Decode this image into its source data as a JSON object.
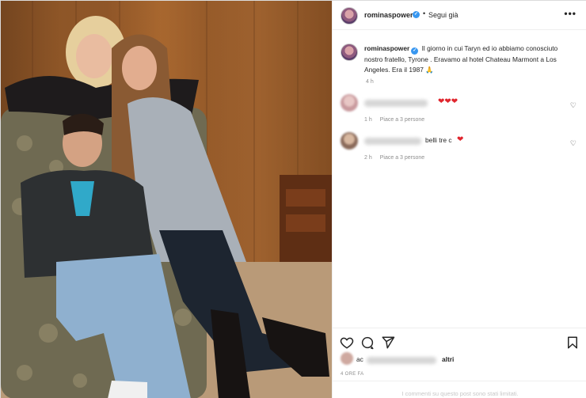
{
  "post": {
    "username": "rominaspower",
    "follow_label": "Segui già",
    "more_label": "•••",
    "caption_username": "rominaspower",
    "caption_text": " Il giorno in cui Taryn ed io abbiamo conosciuto nostro fratello, Tyrone . Eravamo al hotel Chateau Marmont a Los Angeles. Era il 1987 🙏",
    "caption_time": "4 h"
  },
  "comments": [
    {
      "visible_text": "❤❤❤",
      "time": "1 h",
      "likes": "Piace a 3 persone"
    },
    {
      "visible_text": "belli tre c",
      "emoji": "❤",
      "time": "2 h",
      "likes": "Piace a 3 persone"
    }
  ],
  "footer": {
    "likes_prefix": "ac",
    "likes_suffix": "altri",
    "ago": "4 ORE FA",
    "limited_notice": "I commenti su questo post sono stati limitati."
  },
  "icons": {
    "like": "heart-icon",
    "comment": "comment-icon",
    "share": "share-icon",
    "save": "bookmark-icon",
    "verified": "verified-badge-icon",
    "more": "more-options-icon"
  },
  "colors": {
    "verified": "#3897f0",
    "heart_emoji": "#e0262e",
    "text": "#262626",
    "muted": "#8e8e8e"
  }
}
